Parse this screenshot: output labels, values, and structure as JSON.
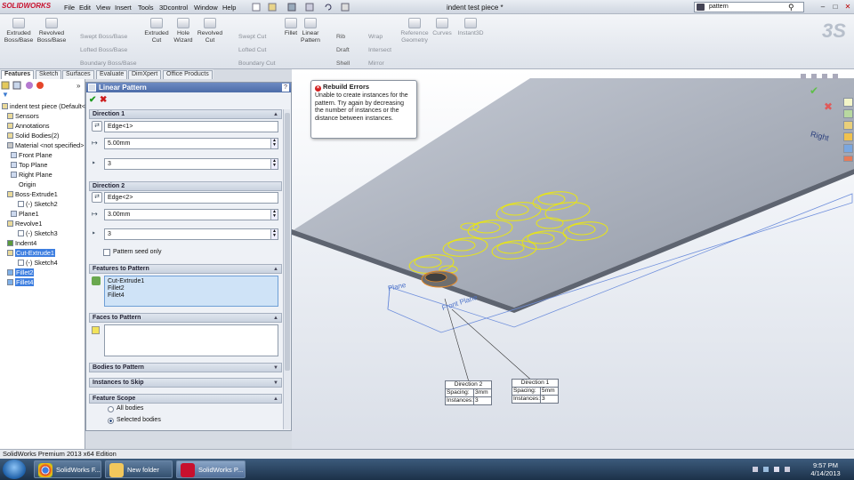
{
  "app": {
    "logo": "SOLIDWORKS",
    "doc_title": "indent test piece *",
    "search_value": "pattern"
  },
  "menu": [
    "File",
    "Edit",
    "View",
    "Insert",
    "Tools",
    "3Dcontrol",
    "Window",
    "Help"
  ],
  "commands": {
    "extruded_boss": "Extruded\nBoss/Base",
    "revolved_boss": "Revolved\nBoss/Base",
    "swept_boss": "Swept Boss/Base",
    "lofted_boss": "Lofted Boss/Base",
    "boundary_boss": "Boundary Boss/Base",
    "extruded_cut": "Extruded\nCut",
    "hole_wizard": "Hole\nWizard",
    "revolved_cut": "Revolved\nCut",
    "swept_cut": "Swept Cut",
    "lofted_cut": "Lofted Cut",
    "boundary_cut": "Boundary Cut",
    "fillet": "Fillet",
    "linear_pattern": "Linear\nPattern",
    "rib": "Rib",
    "draft": "Draft",
    "shell": "Shell",
    "wrap": "Wrap",
    "intersect": "Intersect",
    "mirror": "Mirror",
    "reference_geometry": "Reference\nGeometry",
    "curves": "Curves",
    "instant3d": "Instant3D"
  },
  "tabs": [
    "Features",
    "Sketch",
    "Surfaces",
    "Evaluate",
    "DimXpert",
    "Office Products"
  ],
  "tree": [
    {
      "label": "indent test piece  (Default<"
    },
    {
      "label": "Sensors"
    },
    {
      "label": "Annotations"
    },
    {
      "label": "Solid Bodies(2)"
    },
    {
      "label": "Material <not specified>"
    },
    {
      "label": "Front Plane"
    },
    {
      "label": "Top Plane"
    },
    {
      "label": "Right Plane"
    },
    {
      "label": "Origin"
    },
    {
      "label": "Boss-Extrude1"
    },
    {
      "label": "(-) Sketch2"
    },
    {
      "label": "Plane1"
    },
    {
      "label": "Revolve1"
    },
    {
      "label": "(-) Sketch3"
    },
    {
      "label": "Indent4"
    },
    {
      "label": "Cut-Extrude1"
    },
    {
      "label": "(-) Sketch4"
    },
    {
      "label": "Fillet2"
    },
    {
      "label": "Fillet4"
    }
  ],
  "pm": {
    "title": "Linear Pattern",
    "direction1": {
      "header": "Direction 1",
      "edge": "Edge<1>",
      "spacing": "5.00mm",
      "instances": "3"
    },
    "direction2": {
      "header": "Direction 2",
      "edge": "Edge<2>",
      "spacing": "3.00mm",
      "instances": "3",
      "seed_only": "Pattern seed only"
    },
    "features_header": "Features to Pattern",
    "features": [
      "Cut-Extrude1",
      "Fillet2",
      "Fillet4"
    ],
    "faces_header": "Faces to Pattern",
    "bodies_header": "Bodies to Pattern",
    "skip_header": "Instances to Skip",
    "scope_header": "Feature Scope",
    "scope_all": "All bodies",
    "scope_selected": "Selected bodies"
  },
  "tooltip": {
    "title": "Rebuild Errors",
    "body": "Unable to create instances for the pattern. Try again by decreasing the number of instances or the distance between instances."
  },
  "callouts": {
    "d2": {
      "title": "Direction 2",
      "spacing_label": "Spacing:",
      "spacing": "3mm",
      "instances_label": "Instances:",
      "instances": "3"
    },
    "d1": {
      "title": "Direction 1",
      "spacing_label": "Spacing:",
      "spacing": "5mm",
      "instances_label": "Instances:",
      "instances": "3"
    }
  },
  "viewport_labels": {
    "right": "Right",
    "front": "Front Plane",
    "plane": "Plane"
  },
  "status": "SolidWorks Premium 2013 x64 Edition",
  "taskbar": {
    "chrome": "SolidWorks F...",
    "folder": "New folder",
    "sw": "SolidWorks P...",
    "time": "9:57 PM",
    "date": "4/14/2013"
  }
}
